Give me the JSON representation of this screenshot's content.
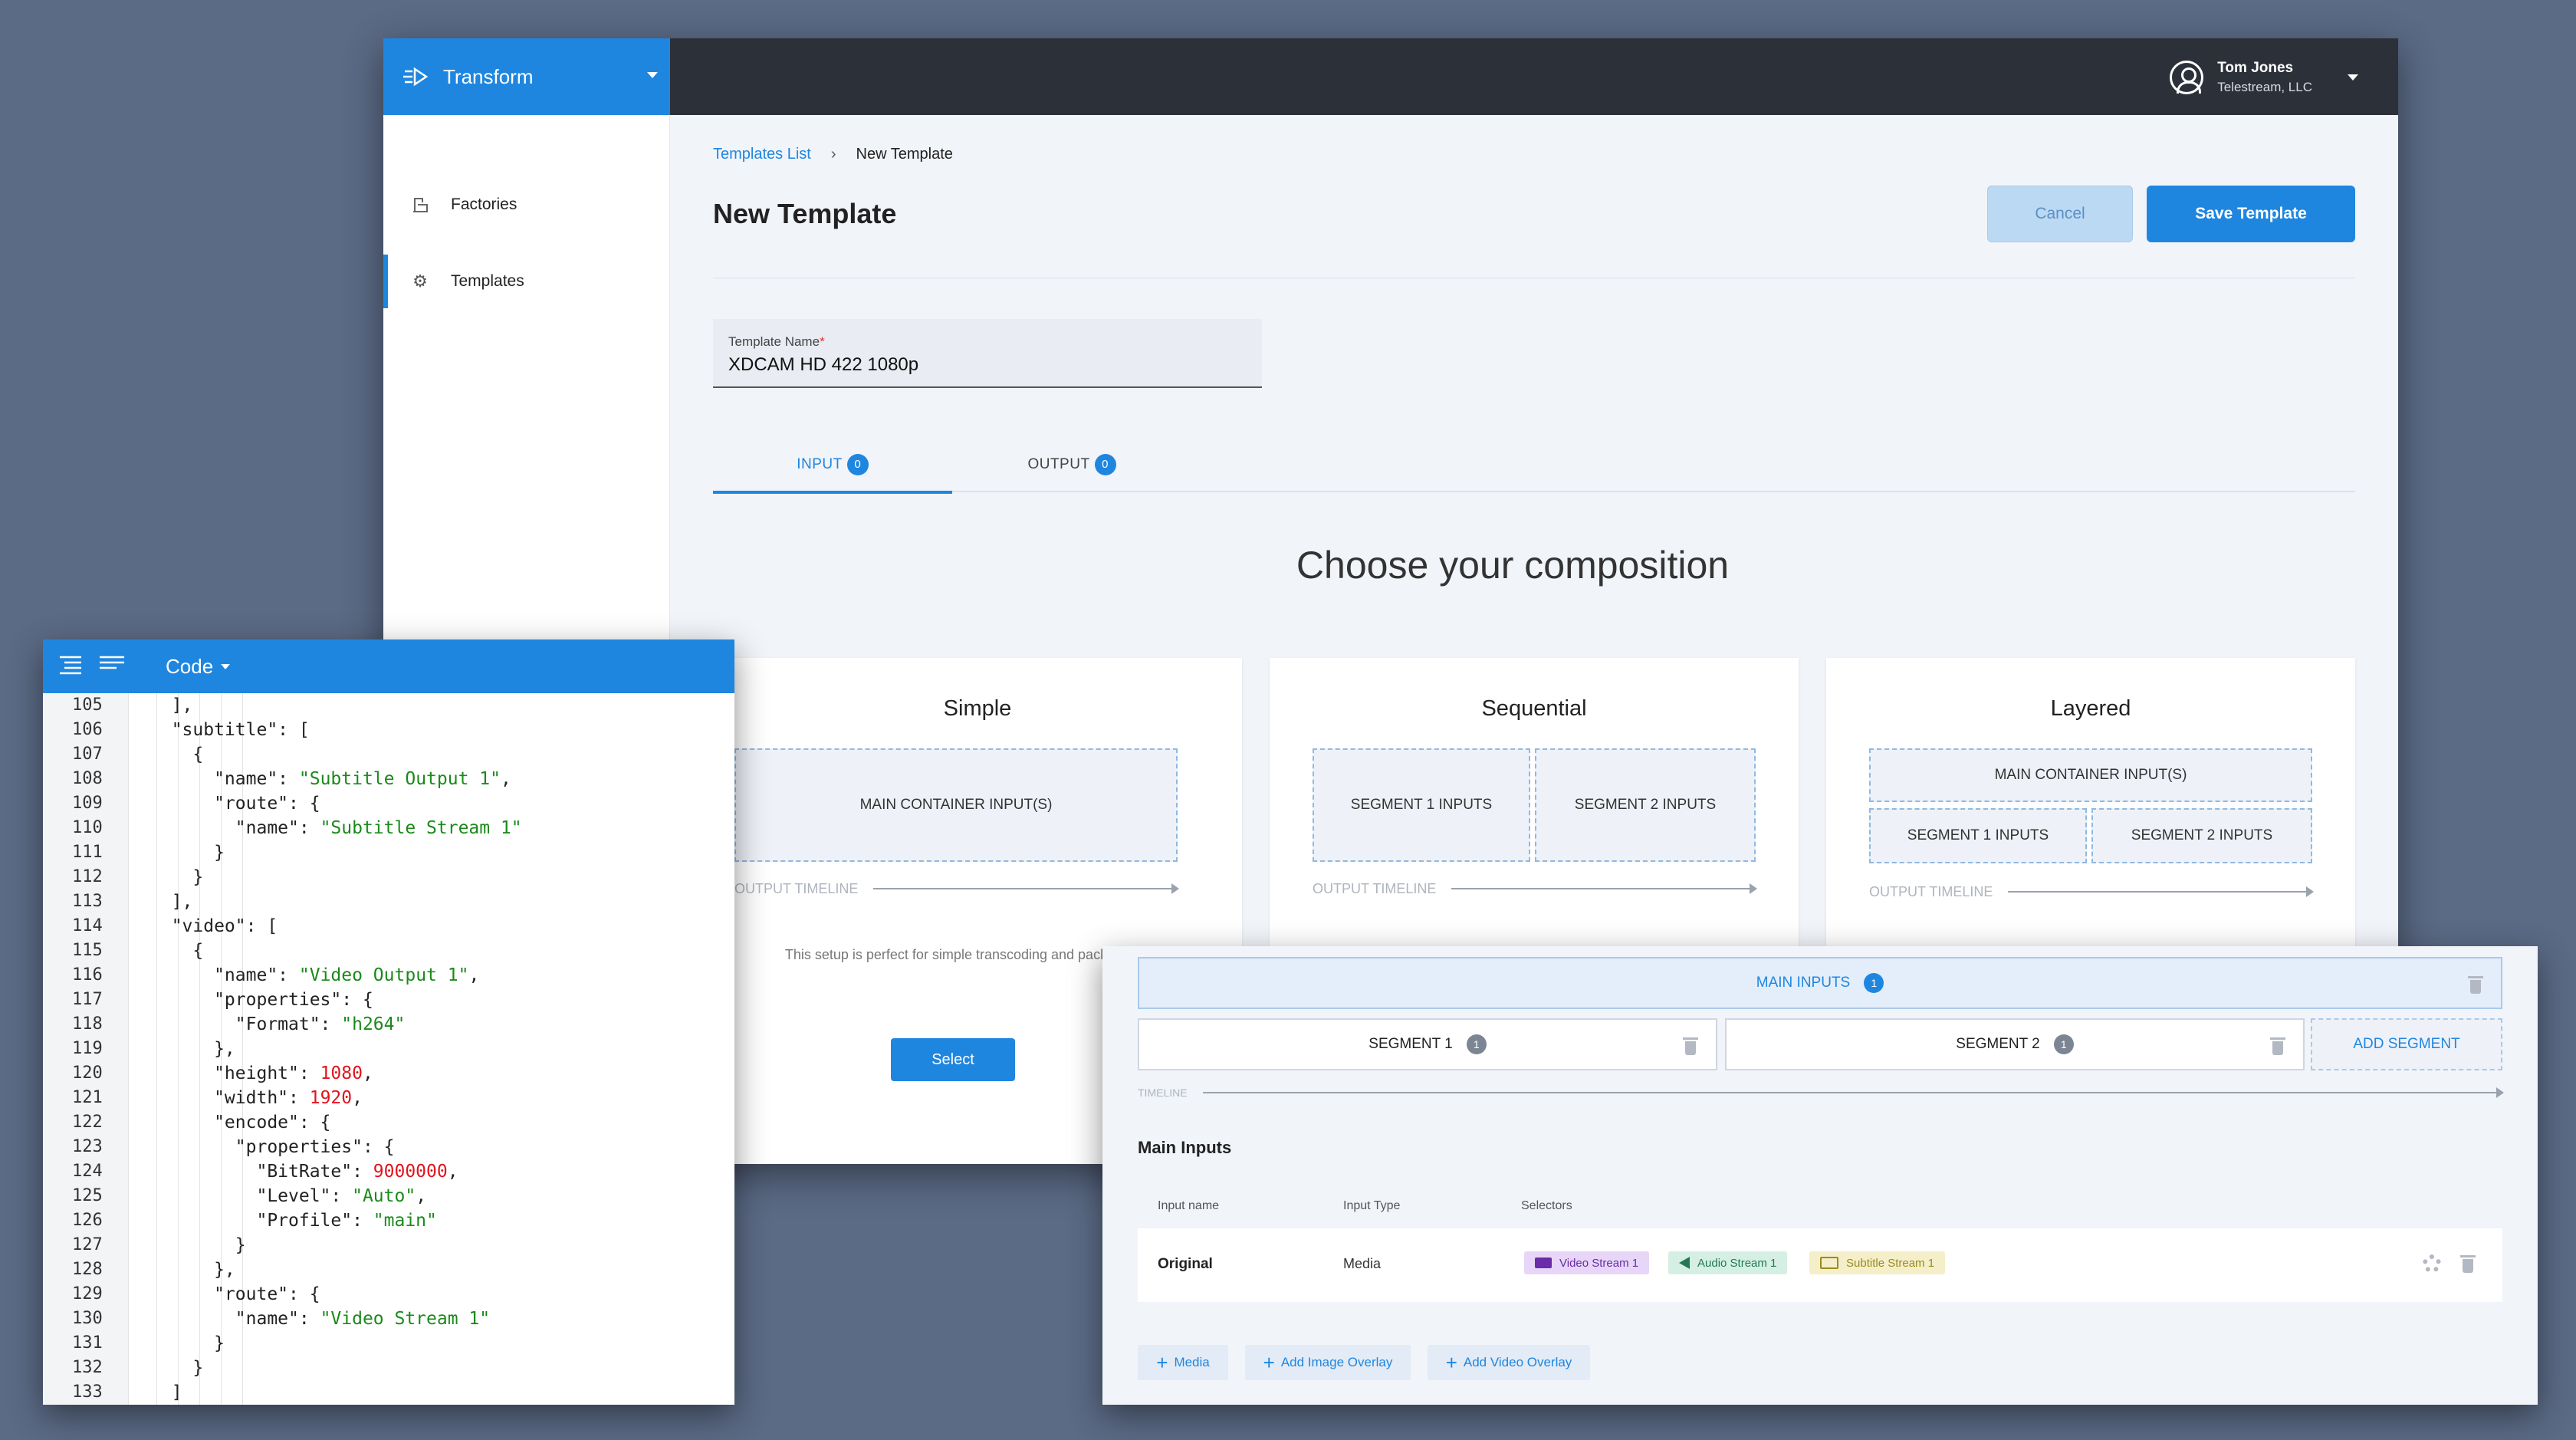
{
  "app": {
    "brand": "Transform",
    "user": {
      "name": "Tom Jones",
      "org": "Telestream, LLC"
    },
    "sidebar": [
      {
        "label": "Factories",
        "icon": "factory-icon"
      },
      {
        "label": "Templates",
        "icon": "gear-icon",
        "active": true
      }
    ],
    "breadcrumb": {
      "parent": "Templates List",
      "separator": "›",
      "current": "New Template"
    },
    "page_title": "New Template",
    "buttons": {
      "cancel": "Cancel",
      "save": "Save Template"
    },
    "template_name": {
      "label": "Template Name",
      "required_mark": "*",
      "value": "XDCAM HD 422 1080p"
    },
    "tabs": [
      {
        "label": "INPUT",
        "count": "0",
        "active": true
      },
      {
        "label": "OUTPUT",
        "count": "0"
      }
    ],
    "compose_title": "Choose your composition",
    "cards": {
      "simple": {
        "title": "Simple",
        "main": "MAIN CONTAINER INPUT(S)",
        "timeline": "OUTPUT TIMELINE",
        "desc": "This setup is perfect for simple transcoding and packaging jobs",
        "select": "Select"
      },
      "sequential": {
        "title": "Sequential",
        "seg1": "SEGMENT 1 INPUTS",
        "seg2": "SEGMENT 2 INPUTS",
        "timeline": "OUTPUT TIMELINE"
      },
      "layered": {
        "title": "Layered",
        "main": "MAIN CONTAINER INPUT(S)",
        "seg1": "SEGMENT 1 INPUTS",
        "seg2": "SEGMENT 2 INPUTS",
        "timeline": "OUTPUT TIMELINE"
      }
    },
    "accent": "#1f86e0"
  },
  "code": {
    "menu_label": "Code",
    "lines": [
      {
        "n": "105",
        "fold": false
      },
      {
        "n": "106",
        "fold": true
      },
      {
        "n": "107",
        "fold": true
      },
      {
        "n": "108",
        "fold": false
      },
      {
        "n": "109",
        "fold": true
      },
      {
        "n": "110",
        "fold": false
      },
      {
        "n": "111",
        "fold": false
      },
      {
        "n": "112",
        "fold": false
      },
      {
        "n": "113",
        "fold": false
      },
      {
        "n": "114",
        "fold": true
      },
      {
        "n": "115",
        "fold": true
      },
      {
        "n": "116",
        "fold": false
      },
      {
        "n": "117",
        "fold": true
      },
      {
        "n": "118",
        "fold": false
      },
      {
        "n": "119",
        "fold": false
      },
      {
        "n": "120",
        "fold": false
      },
      {
        "n": "121",
        "fold": false
      },
      {
        "n": "122",
        "fold": true
      },
      {
        "n": "123",
        "fold": true
      },
      {
        "n": "124",
        "fold": false
      },
      {
        "n": "125",
        "fold": false
      },
      {
        "n": "126",
        "fold": false
      },
      {
        "n": "127",
        "fold": false
      },
      {
        "n": "128",
        "fold": false
      },
      {
        "n": "129",
        "fold": true
      },
      {
        "n": "130",
        "fold": false
      },
      {
        "n": "131",
        "fold": false
      },
      {
        "n": "132",
        "fold": false
      },
      {
        "n": "133",
        "fold": false
      }
    ],
    "text": [
      "  ],",
      "  \"subtitle\": [",
      "    {",
      "      \"name\": \"Subtitle Output 1\",",
      "      \"route\": {",
      "        \"name\": \"Subtitle Stream 1\"",
      "      }",
      "    }",
      "  ],",
      "  \"video\": [",
      "    {",
      "      \"name\": \"Video Output 1\",",
      "      \"properties\": {",
      "        \"Format\": \"h264\"",
      "      },",
      "      \"height\": 1080,",
      "      \"width\": 1920,",
      "      \"encode\": {",
      "        \"properties\": {",
      "          \"BitRate\": 9000000,",
      "          \"Level\": \"Auto\",",
      "          \"Profile\": \"main\"",
      "        }",
      "      },",
      "      \"route\": {",
      "        \"name\": \"Video Stream 1\"",
      "      }",
      "    }",
      "  ]"
    ]
  },
  "segments": {
    "main_inputs": {
      "label": "MAIN INPUTS",
      "count": "1"
    },
    "seg1": {
      "label": "SEGMENT 1",
      "count": "1"
    },
    "seg2": {
      "label": "SEGMENT 2",
      "count": "1"
    },
    "add_segment": "ADD SEGMENT",
    "timeline": "TIMELINE",
    "section_title": "Main Inputs",
    "columns": [
      "Input name",
      "Input Type",
      "Selectors"
    ],
    "row": {
      "name": "Original",
      "type": "Media"
    },
    "chips": [
      {
        "label": "Video Stream 1",
        "icon": "video-camera-icon",
        "bg": "#e7d6f7",
        "fg": "#6a2ca8"
      },
      {
        "label": "Audio Stream 1",
        "icon": "speaker-icon",
        "bg": "#d5efe4",
        "fg": "#227a55"
      },
      {
        "label": "Subtitle Stream 1",
        "icon": "subtitles-icon",
        "bg": "#f4efc9",
        "fg": "#9b8a1e"
      }
    ],
    "add_buttons": [
      "Media",
      "Add Image Overlay",
      "Add Video Overlay"
    ]
  }
}
